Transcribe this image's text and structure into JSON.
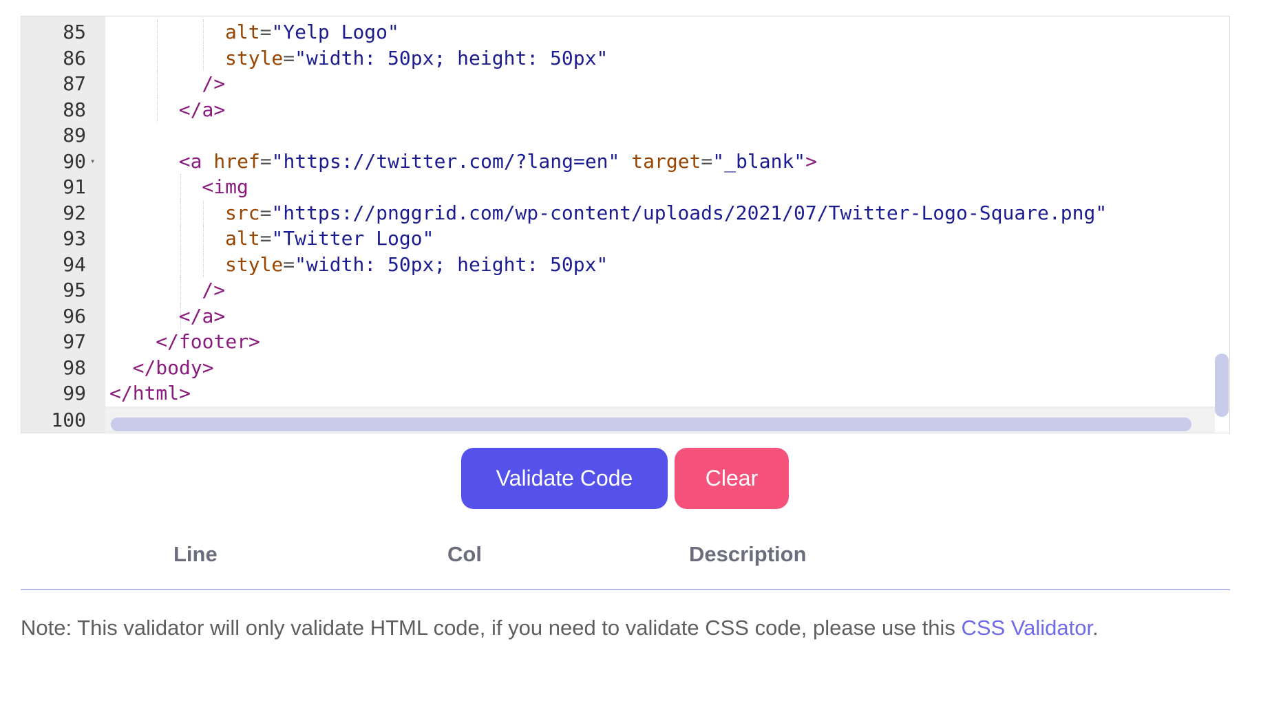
{
  "editor": {
    "lines": [
      {
        "num": "85",
        "tokens": [
          {
            "c": "a",
            "t": "alt"
          },
          {
            "c": "p",
            "t": "="
          },
          {
            "c": "s",
            "t": "\"Yelp Logo\""
          }
        ]
      },
      {
        "num": "86",
        "tokens": [
          {
            "c": "a",
            "t": "style"
          },
          {
            "c": "p",
            "t": "="
          },
          {
            "c": "s",
            "t": "\"width: 50px; height: 50px\""
          }
        ]
      },
      {
        "num": "87",
        "tokens": [
          {
            "c": "t",
            "t": "/>"
          }
        ]
      },
      {
        "num": "88",
        "tokens": [
          {
            "c": "t",
            "t": "</a>"
          }
        ]
      },
      {
        "num": "89",
        "tokens": []
      },
      {
        "num": "90",
        "fold": true,
        "tokens": [
          {
            "c": "t",
            "t": "<a "
          },
          {
            "c": "a",
            "t": "href"
          },
          {
            "c": "p",
            "t": "="
          },
          {
            "c": "s",
            "t": "\"https://twitter.com/?lang=en\" "
          },
          {
            "c": "a",
            "t": "target"
          },
          {
            "c": "p",
            "t": "="
          },
          {
            "c": "s",
            "t": "\"_blank\""
          },
          {
            "c": "t",
            "t": ">"
          }
        ]
      },
      {
        "num": "91",
        "tokens": [
          {
            "c": "t",
            "t": "<img"
          }
        ]
      },
      {
        "num": "92",
        "tokens": [
          {
            "c": "a",
            "t": "src"
          },
          {
            "c": "p",
            "t": "="
          },
          {
            "c": "s",
            "t": "\"https://pnggrid.com/wp-content/uploads/2021/07/Twitter-Logo-Square.png\""
          }
        ]
      },
      {
        "num": "93",
        "tokens": [
          {
            "c": "a",
            "t": "alt"
          },
          {
            "c": "p",
            "t": "="
          },
          {
            "c": "s",
            "t": "\"Twitter Logo\""
          }
        ]
      },
      {
        "num": "94",
        "tokens": [
          {
            "c": "a",
            "t": "style"
          },
          {
            "c": "p",
            "t": "="
          },
          {
            "c": "s",
            "t": "\"width: 50px; height: 50px\""
          }
        ]
      },
      {
        "num": "95",
        "tokens": [
          {
            "c": "t",
            "t": "/>"
          }
        ]
      },
      {
        "num": "96",
        "tokens": [
          {
            "c": "t",
            "t": "</a>"
          }
        ]
      },
      {
        "num": "97",
        "tokens": [
          {
            "c": "t",
            "t": "</footer>"
          }
        ]
      },
      {
        "num": "98",
        "tokens": [
          {
            "c": "t",
            "t": "</body>"
          }
        ]
      },
      {
        "num": "99",
        "tokens": [
          {
            "c": "t",
            "t": "</html>"
          }
        ]
      },
      {
        "num": "100",
        "active": true,
        "tokens": []
      }
    ]
  },
  "buttons": {
    "validate_label": "Validate Code",
    "clear_label": "Clear"
  },
  "results": {
    "col_line": "Line",
    "col_col": "Col",
    "col_description": "Description"
  },
  "note": {
    "text": "Note: This validator will only validate HTML code, if you need to validate CSS code, please use this ",
    "link_text": "CSS Validator",
    "suffix": "."
  },
  "colors": {
    "validate_button": "#5552ec",
    "clear_button": "#f4527a",
    "link": "#6f6be8",
    "tag": "#8a1a7c",
    "attribute": "#994500",
    "string": "#1c1c91"
  }
}
